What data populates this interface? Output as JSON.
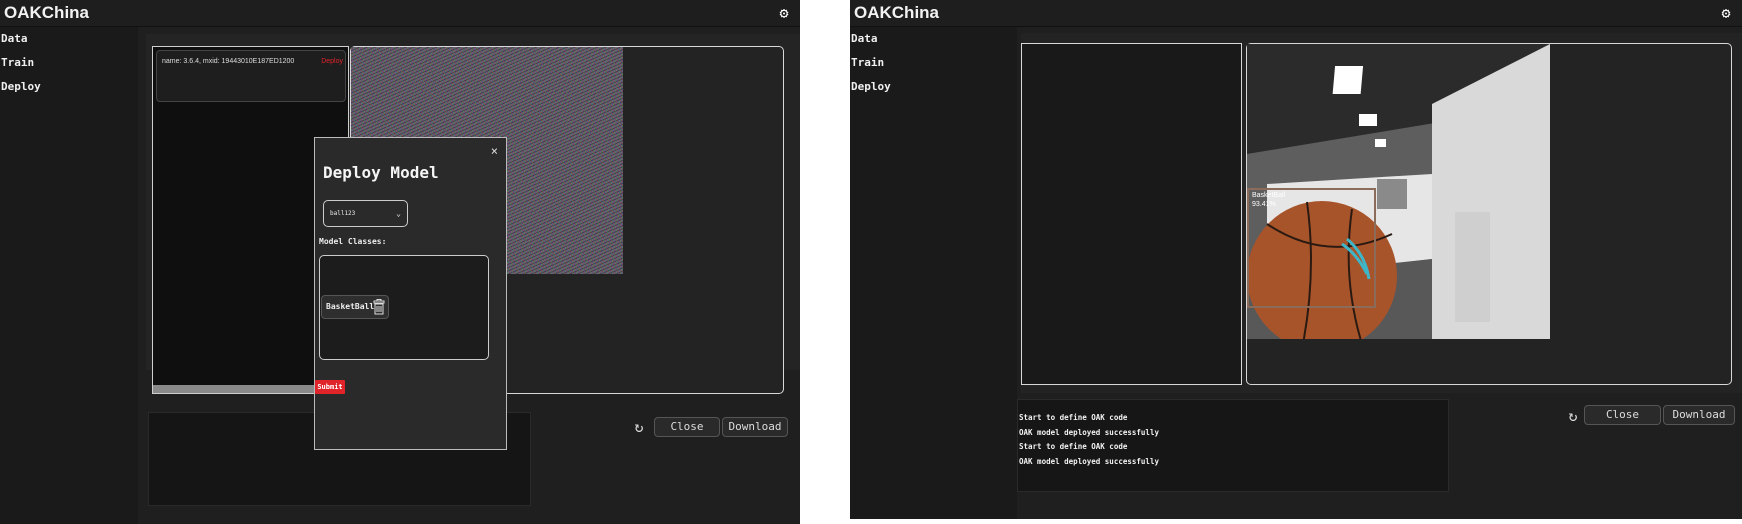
{
  "app": {
    "title": "OAKChina"
  },
  "icons": {
    "settings": "gear-icon",
    "refresh": "refresh-icon",
    "close": "close-icon",
    "delete": "trash-icon",
    "dropdown": "chevron-down-icon"
  },
  "nav": {
    "items": [
      {
        "label": "Data"
      },
      {
        "label": "Train"
      },
      {
        "label": "Deploy"
      }
    ]
  },
  "left": {
    "device_info": "name: 3.6.4, mxid: 19443010E187ED1200",
    "device_action": "Deploy",
    "modal": {
      "title": "Deploy Model",
      "close_symbol": "×",
      "model_select_value": "ball123",
      "classes_label": "Model Classes:",
      "classes": [
        {
          "name": "BasketBall"
        }
      ],
      "submit_label": "Submit"
    },
    "buttons": {
      "close": "Close",
      "download": "Download"
    }
  },
  "right": {
    "detection": {
      "label": "BasketBall",
      "confidence": "93.41%"
    },
    "log_lines": [
      "Start to define OAK code",
      "OAK model deployed successfully",
      "Start to define OAK code",
      "OAK model deployed successfully"
    ],
    "buttons": {
      "close": "Close",
      "download": "Download"
    }
  }
}
